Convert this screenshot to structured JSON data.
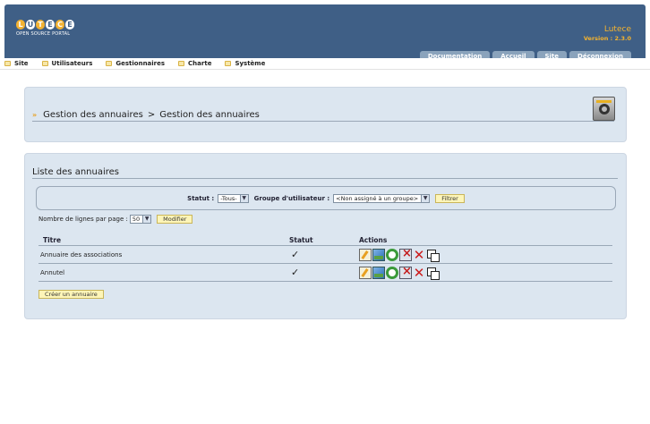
{
  "header": {
    "logo_letters": [
      "L",
      "U",
      "T",
      "E",
      "C",
      "E"
    ],
    "logo_subtitle": "OPEN SOURCE PORTAL",
    "site_name": "Lutece",
    "version": "Version : 2.3.0",
    "tabs": [
      "Documentation",
      "Accueil",
      "Site",
      "Déconnexion"
    ]
  },
  "menu": {
    "items": [
      "Site",
      "Utilisateurs",
      "Gestionnaires",
      "Charte",
      "Système"
    ]
  },
  "breadcrumb": {
    "parent": "Gestion des annuaires",
    "separator": ">",
    "current": "Gestion des annuaires"
  },
  "list": {
    "title": "Liste des annuaires",
    "filter": {
      "status_label": "Statut :",
      "status_value": "-Tous-",
      "group_label": "Groupe d'utilisateur :",
      "group_value": "<Non assigné à un groupe>",
      "filter_button": "Filtrer"
    },
    "rows_per_page": {
      "label": "Nombre de lignes par page :",
      "value": "50",
      "button": "Modifier"
    },
    "columns": [
      "Titre",
      "Statut",
      "Actions"
    ],
    "rows": [
      {
        "title": "Annuaire des associations",
        "status": "✓"
      },
      {
        "title": "Annutel",
        "status": "✓"
      }
    ],
    "create_button": "Créer un annuaire"
  }
}
